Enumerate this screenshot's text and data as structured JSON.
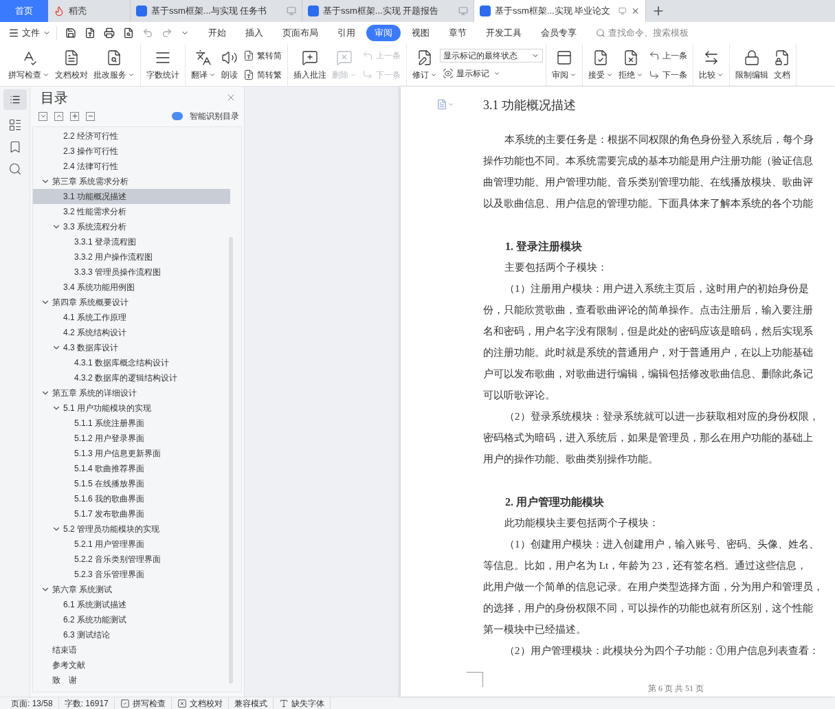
{
  "tabs": [
    {
      "label": "首页",
      "kind": "home",
      "selected": false
    },
    {
      "label": "稻壳",
      "kind": "app",
      "selected": false
    },
    {
      "label": "基于ssm框架...与实现 任务书",
      "kind": "doc",
      "selected": false
    },
    {
      "label": "基于ssm框架...实现 开题报告",
      "kind": "doc",
      "selected": false
    },
    {
      "label": "基于ssm框架...实现 毕业论文",
      "kind": "doc",
      "selected": true
    }
  ],
  "menu": {
    "file": "文件",
    "items": [
      {
        "label": "开始",
        "selected": false
      },
      {
        "label": "插入",
        "selected": false
      },
      {
        "label": "页面布局",
        "selected": false
      },
      {
        "label": "引用",
        "selected": false
      },
      {
        "label": "审阅",
        "selected": true
      },
      {
        "label": "视图",
        "selected": false
      },
      {
        "label": "章节",
        "selected": false
      },
      {
        "label": "开发工具",
        "selected": false
      },
      {
        "label": "会员专享",
        "selected": false
      }
    ],
    "search": "查找命令、搜索模板"
  },
  "ribbon": [
    [
      {
        "kind": "big",
        "label": "拼写检查",
        "caret": true,
        "disabled": false
      },
      {
        "kind": "big",
        "label": "文档校对",
        "caret": false,
        "disabled": false
      },
      {
        "kind": "big",
        "label": "批改服务",
        "caret": true,
        "disabled": false
      }
    ],
    [
      {
        "kind": "big",
        "label": "字数统计",
        "caret": false,
        "disabled": false
      }
    ],
    [
      {
        "kind": "big",
        "label": "翻译",
        "caret": true,
        "disabled": false
      },
      {
        "kind": "big",
        "label": "朗读",
        "caret": false,
        "disabled": false
      },
      {
        "kind": "pair",
        "items": [
          {
            "label": "繁转简",
            "caret": false,
            "disabled": false
          },
          {
            "label": "简转繁",
            "caret": false,
            "disabled": false
          }
        ]
      }
    ],
    [
      {
        "kind": "big",
        "label": "插入批注",
        "caret": false,
        "disabled": false
      },
      {
        "kind": "big",
        "label": "删除",
        "caret": true,
        "disabled": true
      },
      {
        "kind": "pair",
        "items": [
          {
            "label": "上一条",
            "caret": false,
            "disabled": true
          },
          {
            "label": "下一条",
            "caret": false,
            "disabled": true
          }
        ]
      }
    ],
    [
      {
        "kind": "big",
        "label": "修订",
        "caret": true,
        "disabled": false
      },
      {
        "kind": "select",
        "value": "显示标记的最终状态",
        "item": {
          "label": "显示标记",
          "caret": true,
          "disabled": false
        }
      }
    ],
    [
      {
        "kind": "big",
        "label": "审阅",
        "caret": true,
        "disabled": false
      }
    ],
    [
      {
        "kind": "big",
        "label": "接受",
        "caret": true,
        "disabled": false
      },
      {
        "kind": "big",
        "label": "拒绝",
        "caret": true,
        "disabled": false
      },
      {
        "kind": "pair",
        "items": [
          {
            "label": "上一条",
            "caret": false,
            "disabled": false
          },
          {
            "label": "下一条",
            "caret": false,
            "disabled": false
          }
        ]
      }
    ],
    [
      {
        "kind": "big",
        "label": "比较",
        "caret": true,
        "disabled": false
      }
    ],
    [
      {
        "kind": "big",
        "label": "限制编辑",
        "caret": false,
        "disabled": false
      },
      {
        "kind": "big",
        "label": "文档",
        "caret": false,
        "disabled": false
      }
    ]
  ],
  "sidebar": {
    "title": "目录",
    "smart": "智能识别目录",
    "continued_items": [
      {
        "label": "2.2  经济可行性",
        "selected": false
      },
      {
        "label": "2.3  操作可行性",
        "selected": false
      },
      {
        "label": "2.4  法律可行性",
        "selected": false
      }
    ],
    "items": [
      {
        "label": "第三章  系统需求分析",
        "selected": false,
        "expanded": true,
        "children": [
          {
            "label": "3.1  功能概况描述",
            "selected": true
          },
          {
            "label": "3.2 性能需求分析",
            "selected": false
          },
          {
            "label": "3.3 系统流程分析",
            "selected": false,
            "expanded": true,
            "children": [
              {
                "label": "3.3.1 登录流程图",
                "selected": false
              },
              {
                "label": "3.3.2 用户操作流程图",
                "selected": false
              },
              {
                "label": "3.3.3 管理员操作流程图",
                "selected": false
              }
            ]
          },
          {
            "label": "3.4 系统功能用例图",
            "selected": false
          }
        ]
      },
      {
        "label": "第四章  系统概要设计",
        "selected": false,
        "expanded": true,
        "children": [
          {
            "label": "4.1 系统工作原理",
            "selected": false
          },
          {
            "label": "4.2  系统结构设计",
            "selected": false
          },
          {
            "label": "4.3  数据库设计",
            "selected": false,
            "expanded": true,
            "children": [
              {
                "label": "4.3.1 数据库概念结构设计",
                "selected": false
              },
              {
                "label": "4.3.2 数据库的逻辑结构设计",
                "selected": false
              }
            ]
          }
        ]
      },
      {
        "label": "第五章  系统的详细设计",
        "selected": false,
        "expanded": true,
        "children": [
          {
            "label": "5.1  用户功能模块的实现",
            "selected": false,
            "expanded": true,
            "children": [
              {
                "label": "5.1.1 系统注册界面",
                "selected": false
              },
              {
                "label": "5.1.2 用户登录界面",
                "selected": false
              },
              {
                "label": "5.1.3 用户信息更新界面",
                "selected": false
              },
              {
                "label": "5.1.4 歌曲推荐界面",
                "selected": false
              },
              {
                "label": "5.1.5 在线播放界面",
                "selected": false
              },
              {
                "label": "5.1.6 我的歌曲界面",
                "selected": false
              },
              {
                "label": "5.1.7 发布歌曲界面",
                "selected": false
              }
            ]
          },
          {
            "label": "5.2  管理员功能模块的实现",
            "selected": false,
            "expanded": true,
            "children": [
              {
                "label": "5.2.1 用户管理界面",
                "selected": false
              },
              {
                "label": "5.2.2 音乐类别管理界面",
                "selected": false
              },
              {
                "label": "5.2.3 音乐管理界面",
                "selected": false
              }
            ]
          }
        ]
      },
      {
        "label": "第六章  系统测试",
        "selected": false,
        "expanded": true,
        "children": [
          {
            "label": "6.1 系统测试描述",
            "selected": false
          },
          {
            "label": "6.2 系统功能测试",
            "selected": false
          },
          {
            "label": "6.3 测试结论",
            "selected": false
          }
        ]
      },
      {
        "label": "结束语",
        "selected": false
      },
      {
        "label": "参考文献",
        "selected": false
      },
      {
        "label": "致　谢",
        "selected": false
      }
    ]
  },
  "document": {
    "title": "3.1  功能概况描述",
    "blocks": [
      {
        "kind": "indented",
        "text": "本系统的主要任务是：根据不同权限的角色身份登入系统后，每个身"
      },
      {
        "kind": "line",
        "text": "操作功能也不同。本系统需要完成的基本功能是用户注册功能（验证信息"
      },
      {
        "kind": "line",
        "text": "曲管理功能、用户管理功能、音乐类别管理功能、在线播放模块、歌曲评"
      },
      {
        "kind": "line",
        "text": "以及歌曲信息、用户信息的管理功能。下面具体来了解本系统的各个功能"
      },
      {
        "kind": "subheading",
        "text": "1.  登录注册模块"
      },
      {
        "kind": "indented",
        "text": "主要包括两个子模块："
      },
      {
        "kind": "indented",
        "text": "（1）注册用户模块：用户进入系统主页后，这时用户的初始身份是"
      },
      {
        "kind": "line",
        "text": "份，只能欣赏歌曲，查看歌曲评论的简单操作。点击注册后，输入要注册"
      },
      {
        "kind": "line",
        "text": "名和密码，用户名字没有限制，但是此处的密码应该是暗码，然后实现系"
      },
      {
        "kind": "line",
        "text": "的注册功能。此时就是系统的普通用户，对于普通用户，在以上功能基础"
      },
      {
        "kind": "line",
        "text": "户可以发布歌曲，对歌曲进行编辑，编辑包括修改歌曲信息、删除此条记"
      },
      {
        "kind": "line",
        "text": "可以听歌评论。"
      },
      {
        "kind": "indented",
        "text": "（2）登录系统模块：登录系统就可以进一步获取相对应的身份权限，"
      },
      {
        "kind": "line",
        "text": "密码格式为暗码，进入系统后，如果是管理员，那么在用户功能的基础上"
      },
      {
        "kind": "line",
        "text": "用户的操作功能、歌曲类别操作功能。"
      },
      {
        "kind": "subheading",
        "text": "2.  用户管理功能模块"
      },
      {
        "kind": "indented",
        "text": "此功能模块主要包括两个子模块："
      },
      {
        "kind": "indented",
        "text": "（1）创建用户模块：进入创建用户，输入账号、密码、头像、姓名、"
      },
      {
        "kind": "line",
        "text": "等信息。比如，用户名为 Lt，年龄为 23，还有签名档。通过这些信息，"
      },
      {
        "kind": "line",
        "text": "此用户做一个简单的信息记录。在用户类型选择方面，分为用户和管理员，"
      },
      {
        "kind": "line",
        "text": "的选择，用户的身份权限不同，可以操作的功能也就有所区别，这个性能"
      },
      {
        "kind": "line",
        "text": "第一模块中已经描述。"
      },
      {
        "kind": "indented",
        "text": "（2）用户管理模块：此模块分为四个子功能：①用户信息列表查看："
      }
    ],
    "footer": "第 6 页 共 51 页"
  },
  "status_bar": [
    {
      "kind": "text",
      "label": "页面: 13/58"
    },
    {
      "kind": "text",
      "label": "字数: 16917"
    },
    {
      "kind": "check",
      "label": "拼写检查"
    },
    {
      "kind": "cross",
      "label": "文档校对"
    },
    {
      "kind": "text",
      "label": "兼容模式"
    },
    {
      "kind": "font",
      "label": "缺失字体"
    }
  ]
}
